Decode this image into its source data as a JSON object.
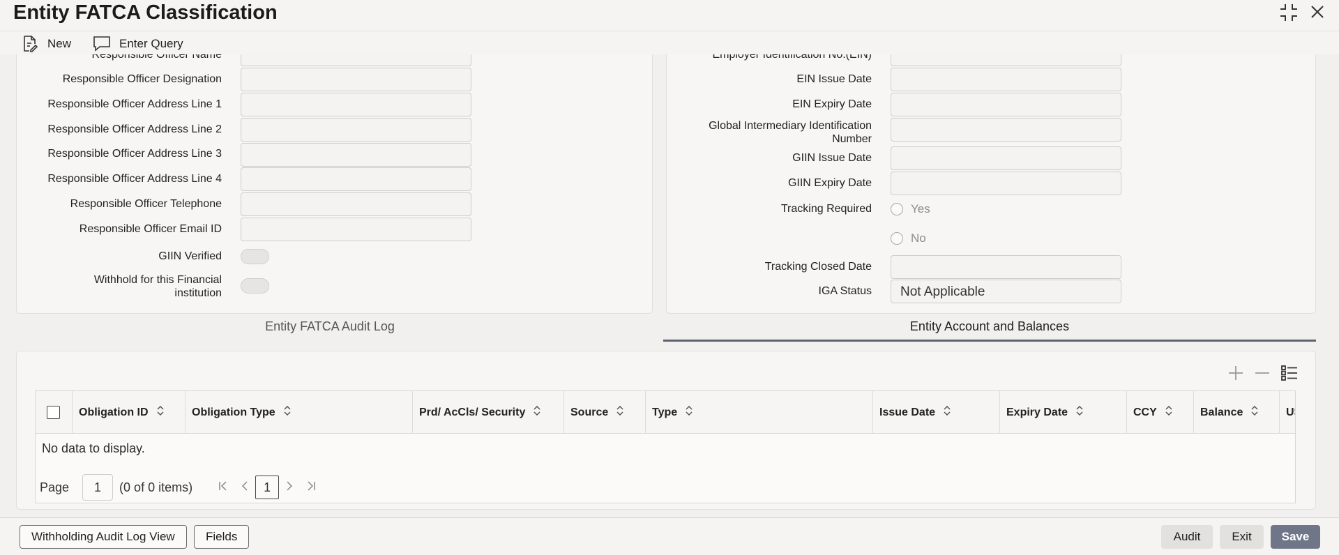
{
  "window": {
    "title": "Entity FATCA Classification"
  },
  "toolbar": {
    "new_label": "New",
    "enter_query_label": "Enter Query"
  },
  "left_form": {
    "labels": {
      "officer_name": "Responsible Officer Name",
      "designation": "Responsible Officer Designation",
      "address1": "Responsible Officer Address Line 1",
      "address2": "Responsible Officer Address Line 2",
      "address3": "Responsible Officer Address Line 3",
      "address4": "Responsible Officer Address Line 4",
      "telephone": "Responsible Officer Telephone",
      "email": "Responsible Officer Email ID",
      "giin_verified": "GIIN Verified",
      "withhold_line1": "Withhold for this Financial",
      "withhold_line2": "institution"
    }
  },
  "right_form": {
    "labels": {
      "ein": "Employer Identification No.(EIN)",
      "ein_issue": "EIN Issue Date",
      "ein_expiry": "EIN Expiry Date",
      "giin_line1": "Global Intermediary Identification",
      "giin_line2": "Number",
      "giin_issue": "GIIN Issue Date",
      "giin_expiry": "GIIN Expiry Date",
      "tracking_required": "Tracking Required",
      "tracking_closed": "Tracking Closed Date",
      "iga_status": "IGA Status"
    },
    "radio_yes": "Yes",
    "radio_no": "No",
    "iga_status_value": "Not Applicable"
  },
  "tabs": {
    "audit_log": "Entity FATCA Audit Log",
    "accounts": "Entity Account and Balances"
  },
  "grid": {
    "columns": [
      "Obligation ID",
      "Obligation Type",
      "Prd/ AcCls/ Security",
      "Source",
      "Type",
      "Issue Date",
      "Expiry Date",
      "CCY",
      "Balance",
      "US"
    ],
    "empty_text": "No data to display.",
    "pager": {
      "page_label": "Page",
      "page_value": "1",
      "items_text": "(0 of 0 items)",
      "current_page": "1"
    }
  },
  "footer": {
    "withholding_btn": "Withholding Audit Log View",
    "fields_btn": "Fields",
    "audit_btn": "Audit",
    "exit_btn": "Exit",
    "save_btn": "Save"
  },
  "colors": {
    "accent": "#6f7688",
    "tab_underline": "#5b6272",
    "background": "#f1f0ee"
  }
}
